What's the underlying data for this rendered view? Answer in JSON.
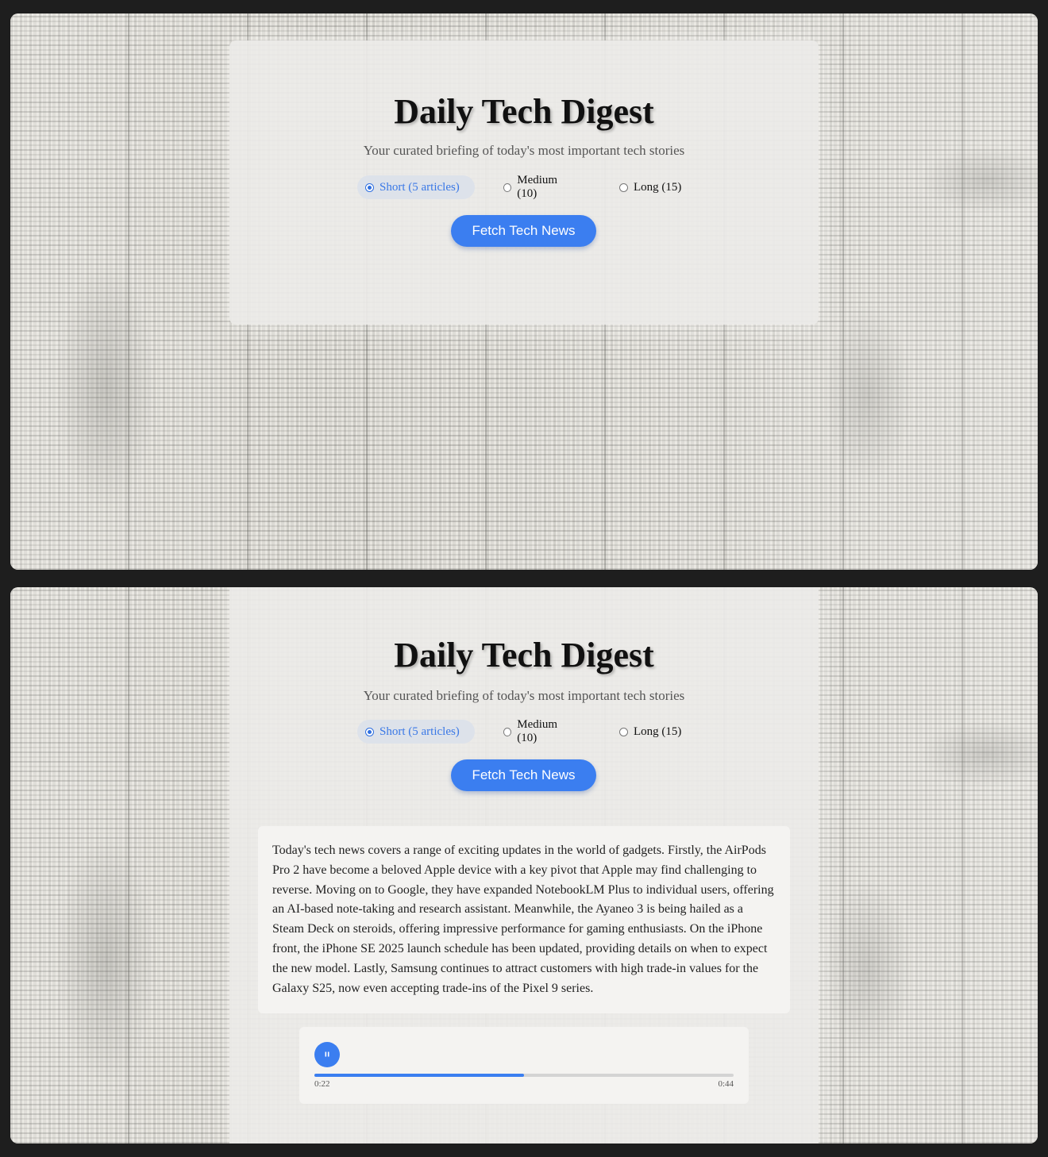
{
  "app": {
    "title": "Daily Tech Digest",
    "subtitle": "Your curated briefing of today's most important tech stories"
  },
  "options": [
    {
      "label": "Short (5 articles)",
      "selected": true
    },
    {
      "label": "Medium (10)",
      "selected": false
    },
    {
      "label": "Long (15)",
      "selected": false
    }
  ],
  "fetch_button": {
    "label": "Fetch Tech News"
  },
  "summary": {
    "text": "Today's tech news covers a range of exciting updates in the world of gadgets. Firstly, the AirPods Pro 2 have become a beloved Apple device with a key pivot that Apple may find challenging to reverse. Moving on to Google, they have expanded NotebookLM Plus to individual users, offering an AI-based note-taking and research assistant. Meanwhile, the Ayaneo 3 is being hailed as a Steam Deck on steroids, offering impressive performance for gaming enthusiasts. On the iPhone front, the iPhone SE 2025 launch schedule has been updated, providing details on when to expect the new model. Lastly, Samsung continues to attract customers with high trade-in values for the Galaxy S25, now even accepting trade-ins of the Pixel 9 series."
  },
  "player": {
    "state_icon": "pause-icon",
    "current_time": "0:22",
    "duration": "0:44",
    "progress": 0.5
  },
  "colors": {
    "accent": "#3b7ef0",
    "selected_bg": "#dde2ea"
  }
}
